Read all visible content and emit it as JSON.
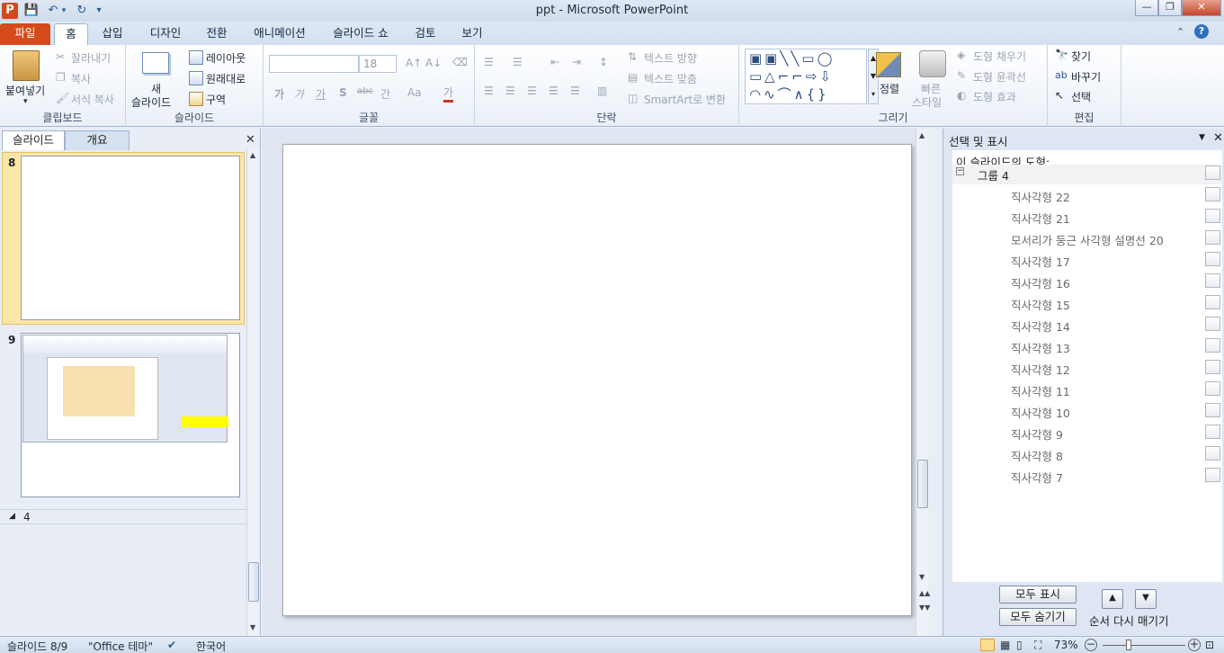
{
  "window": {
    "title": "ppt  -  Microsoft PowerPoint",
    "minimize": "—",
    "restore": "❐",
    "close": "✕"
  },
  "qat": {
    "save": "💾",
    "undo": "↶",
    "redo": "↻",
    "more": "▾"
  },
  "tabs": [
    {
      "label": "파일"
    },
    {
      "label": "홈"
    },
    {
      "label": "삽입"
    },
    {
      "label": "디자인"
    },
    {
      "label": "전환"
    },
    {
      "label": "애니메이션"
    },
    {
      "label": "슬라이드 쇼"
    },
    {
      "label": "검토"
    },
    {
      "label": "보기"
    }
  ],
  "ribbon": {
    "clipboard": {
      "label": "클립보드",
      "paste": "붙여넣기",
      "cut": "잘라내기",
      "copy": "복사",
      "format_painter": "서식 복사"
    },
    "slides": {
      "label": "슬라이드",
      "new_slide_1": "새",
      "new_slide_2": "슬라이드",
      "layout": "레이아웃",
      "reset": "원래대로",
      "section": "구역"
    },
    "font": {
      "label": "글꼴",
      "size": "18",
      "bold": "가",
      "italic": "가",
      "underline": "가",
      "shadow": "S",
      "strike": "abc",
      "spacing": "간",
      "case": "Aa",
      "color": "가"
    },
    "paragraph": {
      "label": "단락",
      "text_direction": "텍스트 방향",
      "align_text": "텍스트 맞춤",
      "smartart": "SmartArt로 변환"
    },
    "drawing": {
      "label": "그리기",
      "arrange": "정렬",
      "quick_styles_1": "빠른",
      "quick_styles_2": "스타일",
      "fill": "도형 채우기",
      "outline": "도형 윤곽선",
      "effects": "도형 효과"
    },
    "editing": {
      "label": "편집",
      "find": "찾기",
      "replace": "바꾸기",
      "select": "선택"
    }
  },
  "left_pane": {
    "tab_slides": "슬라이드",
    "tab_outline": "개요",
    "slide8_num": "8",
    "slide9_num": "9",
    "section": "4"
  },
  "selection_pane": {
    "title": "선택 및 표시",
    "subtitle": "이 슬라이드의 도형:",
    "group": "그룹 4",
    "shapes": [
      "직사각형 22",
      "직사각형 21",
      "모서리가 둥근 사각형 설명선 20",
      "직사각형 17",
      "직사각형 16",
      "직사각형 15",
      "직사각형 14",
      "직사각형 13",
      "직사각형 12",
      "직사각형 11",
      "직사각형 10",
      "직사각형 9",
      "직사각형 8",
      "직사각형 7"
    ],
    "show_all": "모두 표시",
    "hide_all": "모두 숨기기",
    "reorder": "순서 다시 매기기"
  },
  "status": {
    "slide": "슬라이드 8/9",
    "theme": "\"Office 테마\"",
    "language": "한국어",
    "zoom": "73%"
  },
  "colors": {
    "file_tab": "#d44a1a",
    "accent": "#2a5694"
  }
}
